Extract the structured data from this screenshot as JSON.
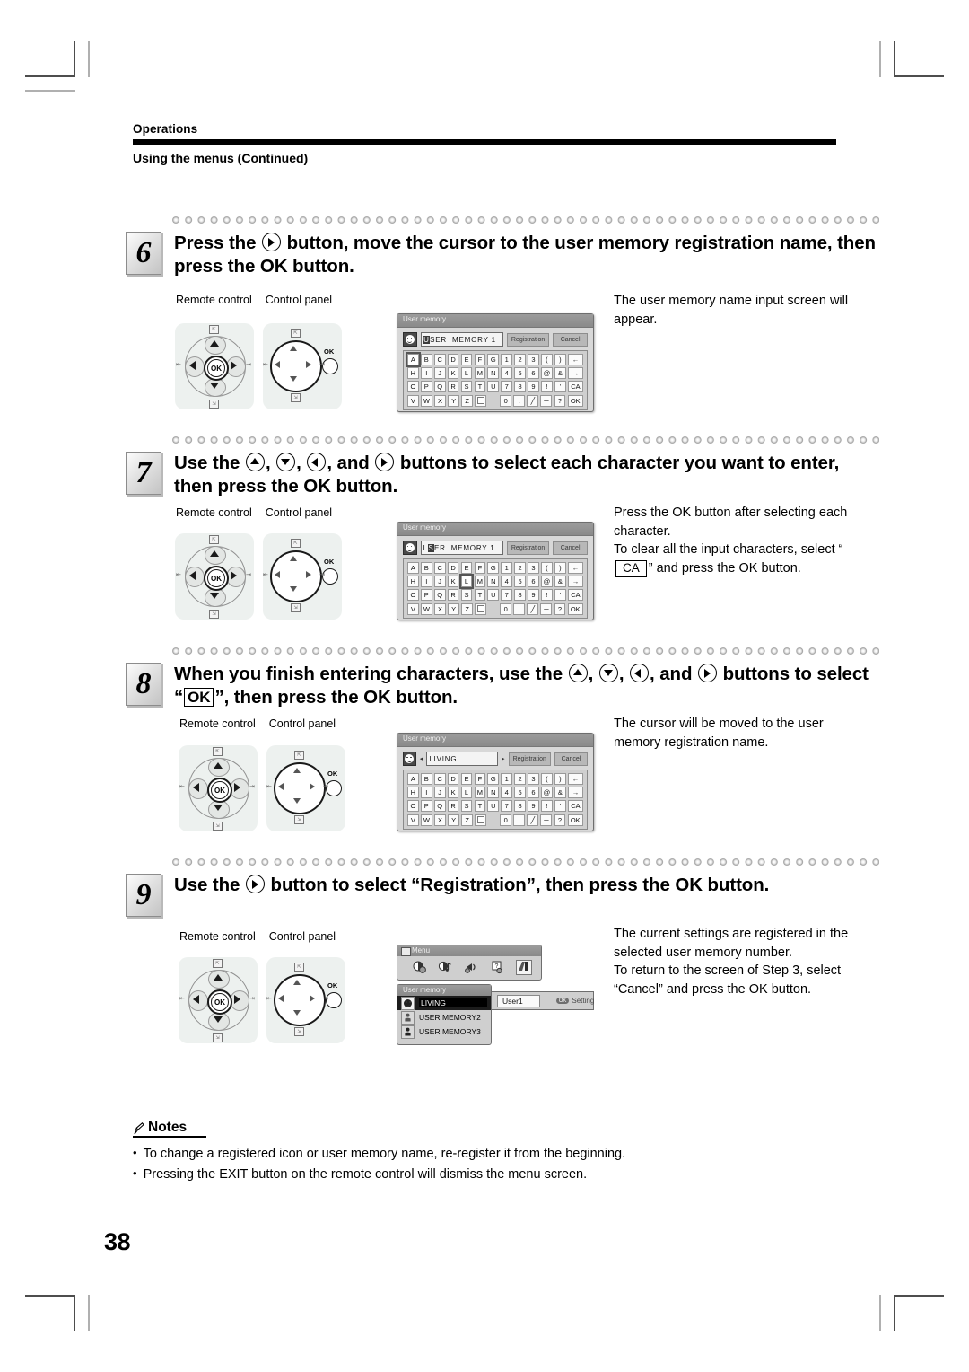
{
  "header": {
    "category": "Operations",
    "title": "Using the menus (Continued)"
  },
  "page_number": "38",
  "figure_labels": {
    "remote": "Remote control",
    "panel": "Control panel"
  },
  "osd_common": {
    "window_title": "User memory",
    "registration_label": "Registration",
    "cancel_label": "Cancel",
    "keys": [
      [
        "A",
        "B",
        "C",
        "D",
        "E",
        "F",
        "G",
        "1",
        "2",
        "3",
        "(",
        ")",
        "←"
      ],
      [
        "H",
        "I",
        "J",
        "K",
        "L",
        "M",
        "N",
        "4",
        "5",
        "6",
        "@",
        "&",
        "→"
      ],
      [
        "O",
        "P",
        "Q",
        "R",
        "S",
        "T",
        "U",
        "7",
        "8",
        "9",
        "!",
        "'",
        "CA"
      ],
      [
        "V",
        "W",
        "X",
        "Y",
        "Z",
        "□",
        "0",
        ".",
        "╱",
        "─",
        "?",
        "OK"
      ]
    ]
  },
  "steps": [
    {
      "number": "6",
      "title_parts": {
        "a": "Press the ",
        "icon1": "right-arrow-button-icon",
        "b": " button, move the cursor to the user memory registration name, then press the OK button."
      },
      "osd": {
        "name_value": "USER  MEMORY 1",
        "cursor_char": "U",
        "selected_key": "A"
      },
      "side_text": "The user memory name input screen will appear."
    },
    {
      "number": "7",
      "title_parts": {
        "a": "Use the ",
        "b": ", ",
        "c": ", ",
        "d": ", and ",
        "e": " buttons to select each character you want to enter, then press the OK button."
      },
      "osd": {
        "name_value": "LSER  MEMORY 1",
        "cursor_char": "S",
        "selected_key": "L"
      },
      "side_text_1": "Press the OK button after selecting each character.",
      "side_text_2a": "To clear all the input characters, select “",
      "side_text_2b": "CA",
      "side_text_2c": "” and press the OK button."
    },
    {
      "number": "8",
      "title_parts": {
        "a": "When you finish entering characters, use the ",
        "b": ", ",
        "c": ", ",
        "d": ", and ",
        "e": " buttons to select “",
        "ok": "OK",
        "f": "”, then press the OK button."
      },
      "osd": {
        "name_value": "LIVING",
        "cursor_char": "",
        "selected_key": ""
      },
      "side_text": "The cursor will be moved to the user memory registration name."
    },
    {
      "number": "9",
      "title_parts": {
        "a": "Use the ",
        "icon1": "right-arrow-button-icon",
        "b": " button to select “Registration”, then press the OK button."
      },
      "menu": {
        "menu_title": "Menu",
        "user_memory_title": "User memory",
        "rows": [
          {
            "label": "LIVING",
            "selected": true
          },
          {
            "label": "USER MEMORY2",
            "selected": false
          },
          {
            "label": "USER MEMORY3",
            "selected": false
          }
        ],
        "user_slot_name": "User1",
        "setting_label": "Setting",
        "ok_pill": "OK"
      },
      "side_text": "The current settings are registered in the selected user memory number.\nTo return to the screen of Step 3, select “Cancel” and press the OK button."
    }
  ],
  "notes": {
    "title": "Notes",
    "items": [
      "To change a registered icon or user memory name, re-register it from the beginning.",
      "Pressing the EXIT button on the remote control will dismiss the menu screen."
    ],
    "bullet": "•"
  }
}
